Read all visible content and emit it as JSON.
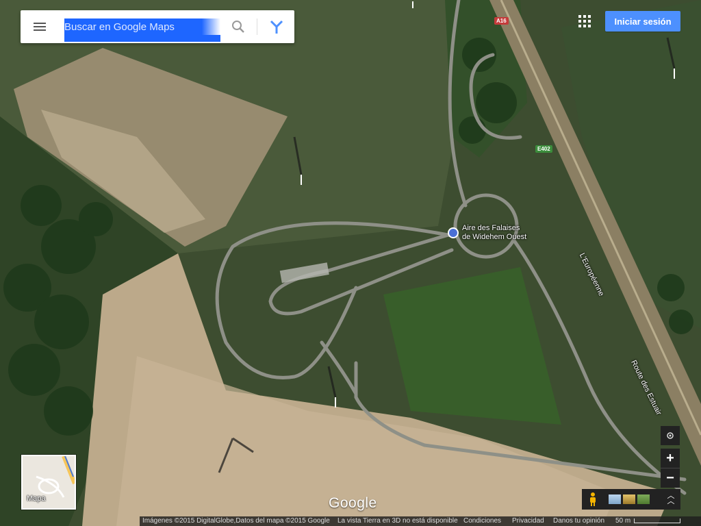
{
  "search": {
    "placeholder": "Buscar en Google Maps"
  },
  "header": {
    "signin_label": "Iniciar sesión"
  },
  "map_labels": {
    "place_line1": "Aire des Falaises",
    "place_line2": "de Widehem Ouest",
    "road_europeenne": "L'Européenne",
    "road_estuaires": "Route des Estuair",
    "shield_a16": "A16",
    "shield_e402": "E402"
  },
  "minimap": {
    "label": "Mapa"
  },
  "brand": {
    "logo": "Google"
  },
  "footer": {
    "imagery": "Imágenes ©2015 DigitalGlobe,Datos del mapa ©2015 Google",
    "earth3d": "La vista Tierra en 3D no está disponible",
    "terms": "Condiciones",
    "privacy": "Privacidad",
    "feedback": "Danos tu opinión",
    "scale": "50 m"
  },
  "colors": {
    "signin_bg": "#4d90fe",
    "search_highlight": "#1e66ff",
    "shield_a16": "#c43b3b",
    "shield_e402": "#3c8d3c"
  }
}
